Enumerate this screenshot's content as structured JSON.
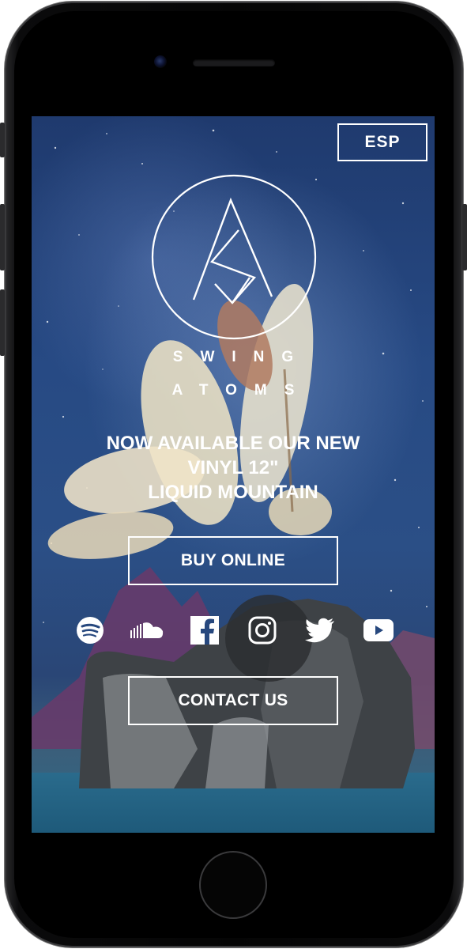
{
  "language_button": {
    "label": "ESP"
  },
  "brand": {
    "line1": "SWING",
    "line2": "ATOMS"
  },
  "headline": {
    "line1": "NOW AVAILABLE OUR NEW",
    "line2": "VINYL 12\"",
    "line3": "LIQUID MOUNTAIN"
  },
  "buy_button": {
    "label": "BUY ONLINE"
  },
  "contact_button": {
    "label": "CONTACT US"
  },
  "socials": [
    "spotify-icon",
    "soundcloud-icon",
    "facebook-icon",
    "instagram-icon",
    "twitter-icon",
    "youtube-icon"
  ],
  "colors": {
    "text": "#ffffff",
    "sky": "#274a84",
    "phone": "#050505"
  }
}
